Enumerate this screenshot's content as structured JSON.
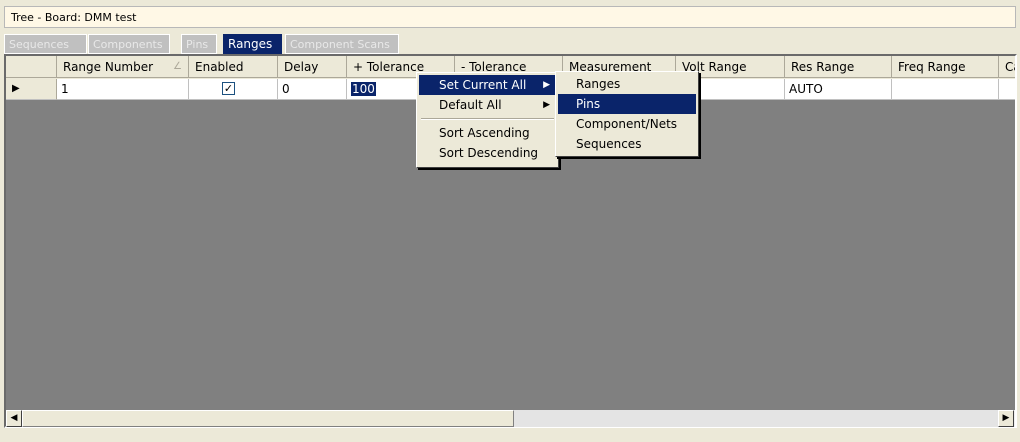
{
  "window": {
    "title": "Tree - Board: DMM test"
  },
  "tabs": [
    {
      "label": "Sequences"
    },
    {
      "label": "Components"
    },
    {
      "label": "Pins"
    },
    {
      "label": "Ranges"
    },
    {
      "label": "Component Scans"
    }
  ],
  "active_tab": "Ranges",
  "grid": {
    "columns": [
      {
        "label": "Range Number",
        "sort_glyph": "∠"
      },
      {
        "label": "Enabled"
      },
      {
        "label": "Delay"
      },
      {
        "label": "+ Tolerance"
      },
      {
        "label": "- Tolerance"
      },
      {
        "label": "Measurement"
      },
      {
        "label": "Volt Range"
      },
      {
        "label": "Res Range"
      },
      {
        "label": "Freq Range"
      },
      {
        "label": "Ca"
      }
    ],
    "row": {
      "indicator": "▶",
      "range_number": "1",
      "enabled_check": "✓",
      "delay": "0",
      "plus_tolerance": "100",
      "res_range": "AUTO"
    }
  },
  "context_menu": {
    "items": [
      {
        "label": "Set Current All",
        "arrow": "▶"
      },
      {
        "label": "Default All",
        "arrow": "▶"
      },
      {
        "label": "Sort Ascending"
      },
      {
        "label": "Sort Descending"
      }
    ]
  },
  "submenu": {
    "items": [
      {
        "label": "Ranges"
      },
      {
        "label": "Pins"
      },
      {
        "label": "Component/Nets"
      },
      {
        "label": "Sequences"
      }
    ]
  },
  "scrollbar": {
    "left_arrow": "◀",
    "right_arrow": "▶"
  },
  "colors": {
    "highlight": "#0a246a",
    "grid_bg": "#808080",
    "header_bg": "#ece9d8"
  }
}
